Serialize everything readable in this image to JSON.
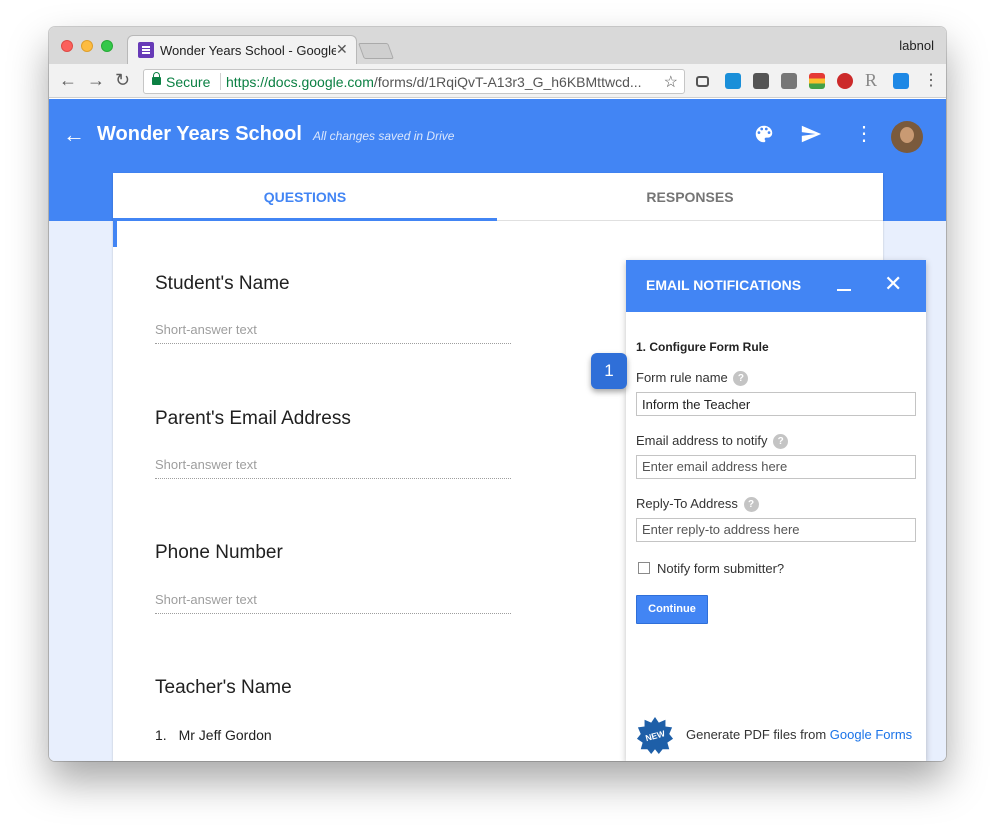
{
  "browser": {
    "tab_title": "Wonder Years School - Google Forms",
    "tab_close": "✕",
    "profile_name": "labnol",
    "url_secure_label": "Secure",
    "url_host": "https://docs.google.com",
    "url_path": "/forms/d/1RqiQvT-A13r3_G_h6KBMttwcd...",
    "back_glyph": "←",
    "forward_glyph": "→",
    "reload_glyph": "↻",
    "star_glyph": "☆",
    "menu_glyph": "⋮",
    "extensions": [
      {
        "icon": "lock-icon",
        "color": "#555555"
      },
      {
        "icon": "trello-icon",
        "color": "#1a8fd9"
      },
      {
        "icon": "pocket-icon",
        "color": "#555555"
      },
      {
        "icon": "keep-icon",
        "color": "#777777"
      },
      {
        "icon": "palette-ext-icon",
        "color": "#e8710a"
      },
      {
        "icon": "lastpass-icon",
        "color": "#cc2a2a"
      },
      {
        "icon": "r-icon",
        "color": "#888888"
      },
      {
        "icon": "share-icon",
        "color": "#1e88e5"
      }
    ]
  },
  "app_header": {
    "back_glyph": "←",
    "title": "Wonder Years School",
    "save_status": "All changes saved in Drive",
    "menu_glyph": "⋮",
    "palette_glyph": "🎨",
    "send_glyph": "➤",
    "accent_color": "#4285f4"
  },
  "tabs": {
    "questions": "QUESTIONS",
    "responses": "RESPONSES"
  },
  "questions": [
    {
      "title": "Student's Name",
      "hint": "Short-answer text"
    },
    {
      "title": "Parent's Email Address",
      "hint": "Short-answer text"
    },
    {
      "title": "Phone Number",
      "hint": "Short-answer text"
    },
    {
      "title": "Teacher's Name",
      "option_number": "1.",
      "option_label": "Mr Jeff Gordon"
    }
  ],
  "panel": {
    "title": "EMAIL NOTIFICATIONS",
    "close_glyph": "✕",
    "section_title": "1. Configure Form Rule",
    "help_glyph": "?",
    "rule_name_label": "Form rule name",
    "rule_name_value": "Inform the Teacher",
    "email_label": "Email address to notify",
    "email_placeholder": "Enter email address here",
    "reply_label": "Reply-To Address",
    "reply_placeholder": "Enter reply-to address here",
    "notify_label": "Notify form submitter?",
    "notify_checked": false,
    "continue_label": "Continue",
    "new_badge": "NEW",
    "promo_text": "Generate PDF files from ",
    "promo_link": "Google Forms"
  },
  "step_badge": "1"
}
